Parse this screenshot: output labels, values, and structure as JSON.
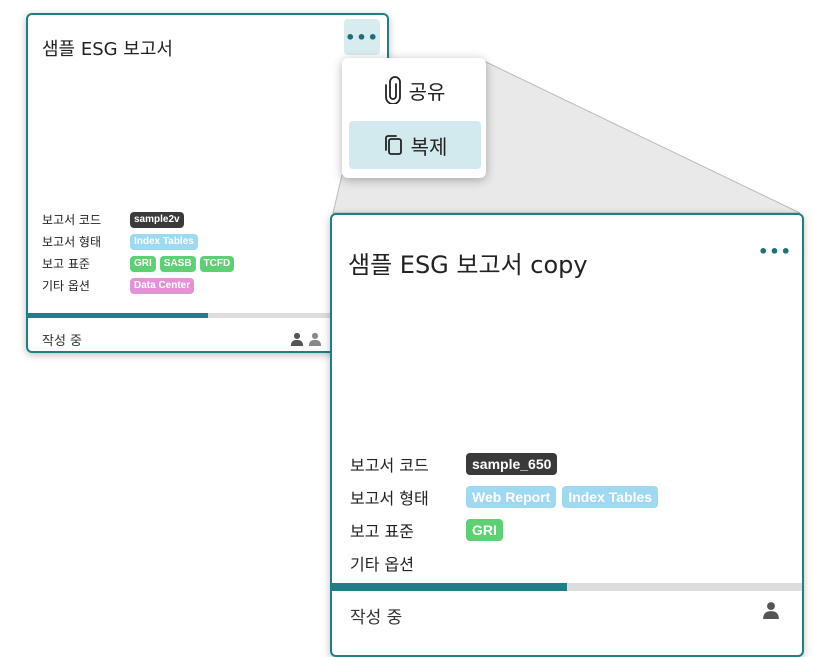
{
  "original_card": {
    "title": "샘플 ESG 보고서",
    "more_label": "•••",
    "meta": {
      "code_label": "보고서 코드",
      "code": "sample2v",
      "type_label": "보고서 형태",
      "types": [
        "Index Tables"
      ],
      "standard_label": "보고 표준",
      "standards": [
        "GRI",
        "SASB",
        "TCFD"
      ],
      "options_label": "기타 옵션",
      "options": [
        "Data Center"
      ]
    },
    "progress_fraction": 0.5,
    "status": "작성 중",
    "owner_count": 2
  },
  "context_menu": {
    "share_label": "공유",
    "copy_label": "복제"
  },
  "copied_card": {
    "title": "샘플 ESG 보고서 copy",
    "more_label": "•••",
    "meta": {
      "code_label": "보고서 코드",
      "code": "sample_650",
      "type_label": "보고서 형태",
      "types": [
        "Web Report",
        "Index Tables"
      ],
      "standard_label": "보고 표준",
      "standards": [
        "GRI"
      ],
      "options_label": "기타 옵션",
      "options": []
    },
    "progress_fraction": 0.5,
    "status": "작성 중",
    "owner_count": 1
  },
  "colors": {
    "accent": "#1e7f86",
    "tag_code": "#3a3a3a",
    "tag_type": "#9fd8f1",
    "tag_standard": "#5dd073",
    "tag_option": "#e392d8",
    "menu_highlight": "#d2eaed"
  },
  "icons": {
    "share": "paperclip-icon",
    "copy": "copy-icon",
    "owner": "user-icon",
    "more": "more-horizontal-icon"
  }
}
